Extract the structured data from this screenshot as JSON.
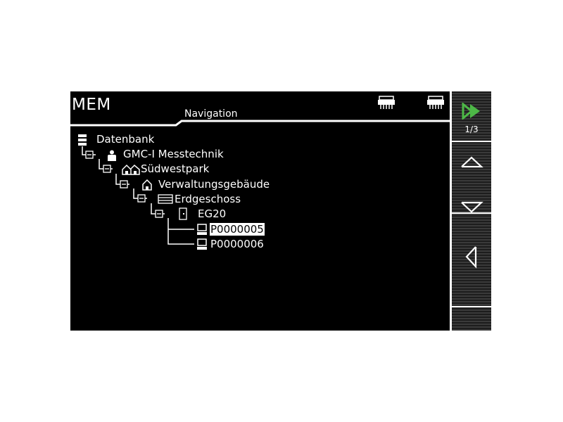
{
  "header": {
    "mode_label": "MEM",
    "title": "Navigation"
  },
  "tree": {
    "nodes": [
      {
        "label": "Datenbank",
        "icon": "database-icon",
        "level": 0
      },
      {
        "label": "GMC-I Messtechnik",
        "icon": "customer-icon",
        "level": 1
      },
      {
        "label": "Südwestpark",
        "icon": "property-icon",
        "level": 2
      },
      {
        "label": "Verwaltungsgebäude",
        "icon": "building-icon",
        "level": 3
      },
      {
        "label": "Erdgeschoss",
        "icon": "floor-icon",
        "level": 4
      },
      {
        "label": "EG20",
        "icon": "room-icon",
        "level": 5
      },
      {
        "label": "P0000005",
        "icon": "device-icon",
        "level": 6,
        "selected": true
      },
      {
        "label": "P0000006",
        "icon": "device-icon",
        "level": 6,
        "selected": false
      }
    ]
  },
  "sidebar": {
    "page_indicator": "1/3",
    "buttons": [
      "next-page-icon",
      "arrow-up-icon",
      "arrow-down-icon",
      "arrow-left-icon"
    ],
    "accent_color": "#4db847"
  }
}
